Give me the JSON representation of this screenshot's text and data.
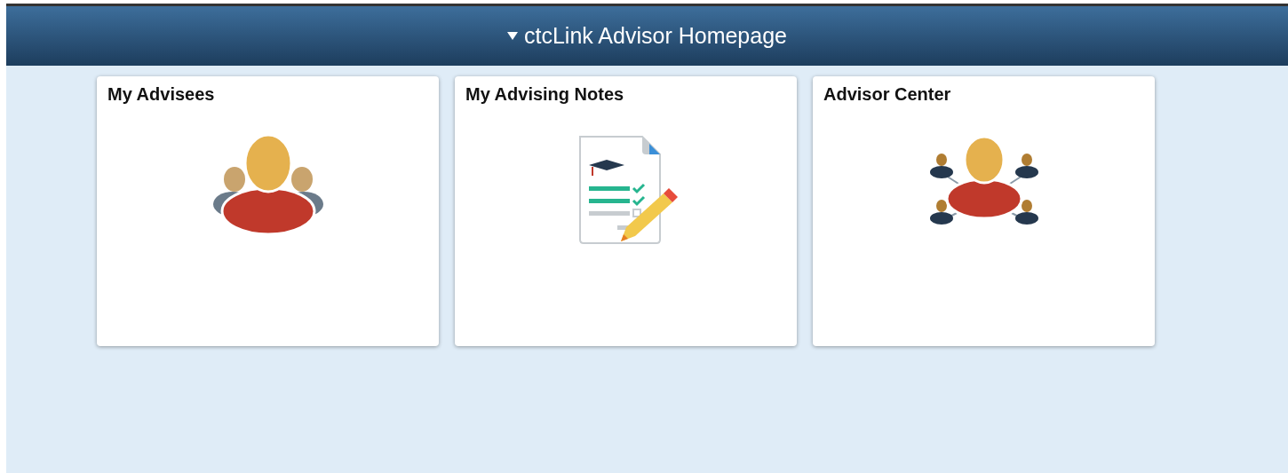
{
  "header": {
    "title": "ctcLink Advisor Homepage"
  },
  "tiles": [
    {
      "title": "My Advisees",
      "kind": "people"
    },
    {
      "title": "My Advising Notes",
      "kind": "notes"
    },
    {
      "title": "Advisor Center",
      "kind": "network"
    }
  ]
}
